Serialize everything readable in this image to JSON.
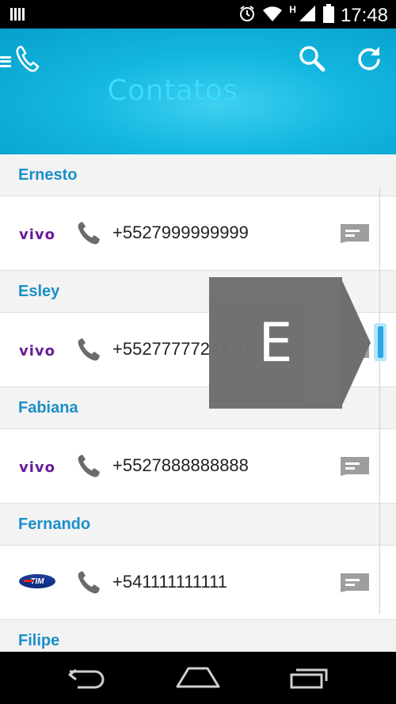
{
  "status_bar": {
    "time": "17:48",
    "network_type": "H",
    "icons": [
      "signal-bars-icon",
      "alarm-icon",
      "wifi-icon",
      "cell-signal-icon",
      "battery-icon"
    ]
  },
  "header": {
    "title": "Contatos",
    "menu_icon": "hamburger-icon",
    "logo_icon": "phone-logo-icon",
    "search_icon": "search-icon",
    "refresh_icon": "refresh-icon",
    "background_color": "#13b7e0",
    "title_color": "#3ddcff"
  },
  "contacts": [
    {
      "name": "Ernesto",
      "carrier": "vivo",
      "number": "+5527999999999"
    },
    {
      "name": "Esley",
      "carrier": "vivo",
      "number": "+5527777724416"
    },
    {
      "name": "Fabiana",
      "carrier": "vivo",
      "number": "+5527888888888"
    },
    {
      "name": "Fernando",
      "carrier": "TIM",
      "number": "+541111111111"
    },
    {
      "name": "Filipe"
    }
  ],
  "fast_scroll": {
    "index_letter": "E"
  },
  "colors": {
    "accent": "#1b8fc9",
    "vivo": "#6a1b9a",
    "scroll_thumb": "#2aa8e6"
  },
  "nav_bar": {
    "icons": [
      "back-icon",
      "home-icon",
      "recent-apps-icon"
    ]
  }
}
